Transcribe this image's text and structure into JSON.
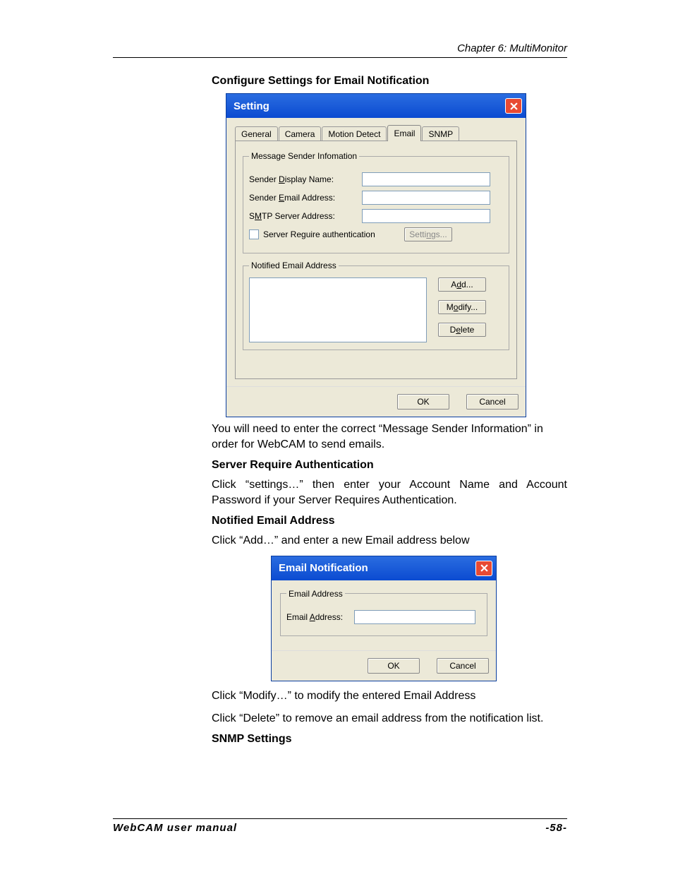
{
  "header": {
    "chapter": "Chapter 6: MultiMonitor"
  },
  "sec1": {
    "title": "Configure Settings for Email Notification"
  },
  "dlg1": {
    "title": "Setting",
    "tabs": {
      "general": "General",
      "camera": "Camera",
      "motion": "Motion Detect",
      "email": "Email",
      "snmp": "SNMP"
    },
    "grp_sender_legend": "Message Sender Infomation",
    "lbl_display": "Sender Display Name:",
    "lbl_email": "Sender Email Address:",
    "lbl_smtp": "SMTP Server Address:",
    "chk_auth": "Server Reguire authentication",
    "btn_settings": "Settings...",
    "val_display": "",
    "val_email": "",
    "val_smtp": "",
    "grp_notified_legend": "Notified Email Address",
    "btn_add": "Add...",
    "btn_modify": "Modify...",
    "btn_delete": "Delete",
    "btn_ok": "OK",
    "btn_cancel": "Cancel"
  },
  "p1": "You will need to enter the correct “Message Sender Information” in order for WebCAM to send emails.",
  "sec2": {
    "title": "Server Require Authentication"
  },
  "p2": "Click “settings…” then enter your Account Name and Account Password if your Server Requires Authentication.",
  "sec3": {
    "title": "Notified Email Address"
  },
  "p3": "Click “Add…” and enter a new Email address below",
  "dlg2": {
    "title": "Email Notification",
    "grp_legend": "Email Address",
    "lbl_addr": "Email Address:",
    "val_addr": "",
    "btn_ok": "OK",
    "btn_cancel": "Cancel"
  },
  "p4": "Click “Modify…” to modify the entered Email Address",
  "p5": "Click “Delete” to remove an email address from the notification list.",
  "sec4": {
    "title": "SNMP Settings"
  },
  "footer": {
    "left": "WebCAM user manual",
    "right": "-58-"
  }
}
